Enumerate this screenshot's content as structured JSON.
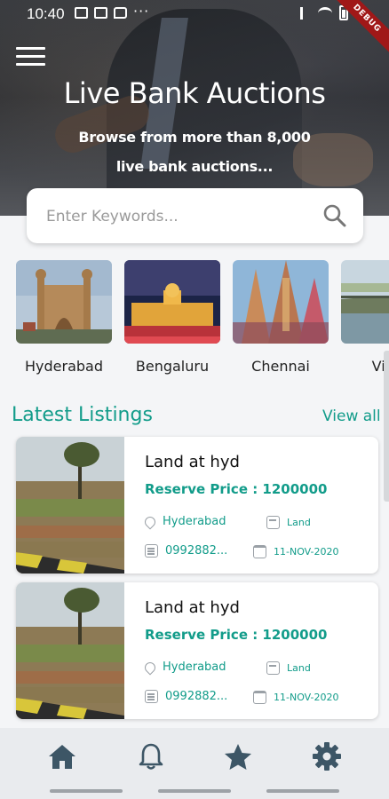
{
  "status_bar": {
    "time": "10:40",
    "overflow": "···",
    "debug_label": "DEBUG"
  },
  "hero": {
    "title": "Live Bank Auctions",
    "subtitle_line1": "Browse from more than 8,000",
    "subtitle_line2": "live bank auctions..."
  },
  "search": {
    "placeholder": "Enter Keywords...",
    "value": ""
  },
  "cities": [
    {
      "name": "Hyderabad"
    },
    {
      "name": "Bengaluru"
    },
    {
      "name": "Chennai"
    },
    {
      "name": "Vijay"
    }
  ],
  "section": {
    "title": "Latest Listings",
    "view_all": "View all"
  },
  "listings": [
    {
      "title": "Land at hyd",
      "price": "Reserve Price : 1200000",
      "city": "Hyderabad",
      "type": "Land",
      "phone": "0992882...",
      "date": "11-NOV-2020"
    },
    {
      "title": "Land at hyd",
      "price": "Reserve Price : 1200000",
      "city": "Hyderabad",
      "type": "Land",
      "phone": "0992882...",
      "date": "11-NOV-2020"
    }
  ],
  "nav": [
    {
      "icon": "home-icon"
    },
    {
      "icon": "bell-icon"
    },
    {
      "icon": "star-icon"
    },
    {
      "icon": "gear-icon"
    }
  ],
  "colors": {
    "accent": "#129c8a",
    "nav_icon": "#3d5666",
    "ribbon": "#a01818"
  }
}
